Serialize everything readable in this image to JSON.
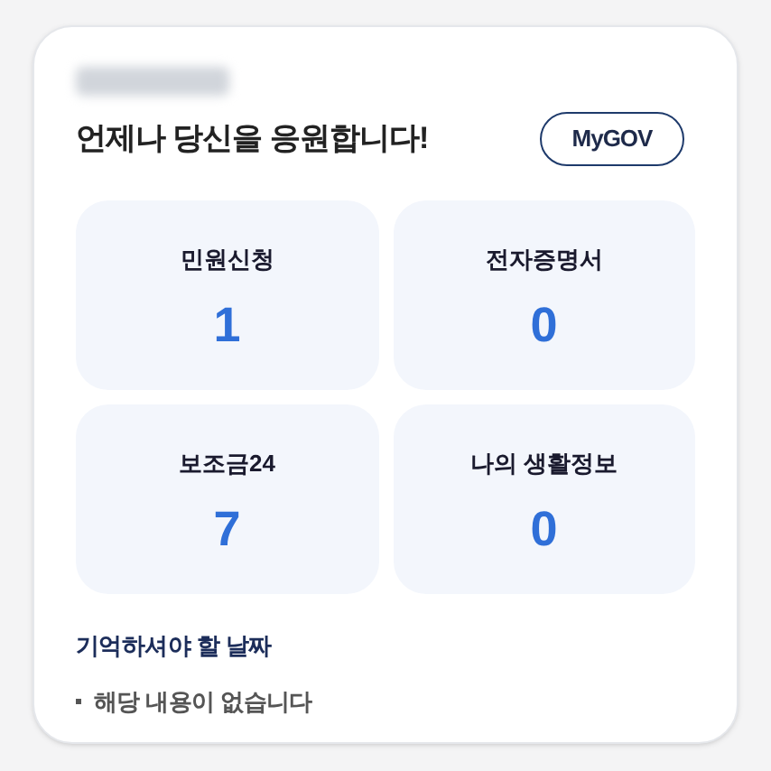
{
  "greeting": "언제나 당신을 응원합니다!",
  "mygov_button": "MyGOV",
  "tiles": [
    {
      "label": "민원신청",
      "count": "1"
    },
    {
      "label": "전자증명서",
      "count": "0"
    },
    {
      "label": "보조금24",
      "count": "7"
    },
    {
      "label": "나의 생활정보",
      "count": "0"
    }
  ],
  "reminders": {
    "title": "기억하셔야 할 날짜",
    "items": [
      "해당 내용이 없습니다"
    ]
  }
}
